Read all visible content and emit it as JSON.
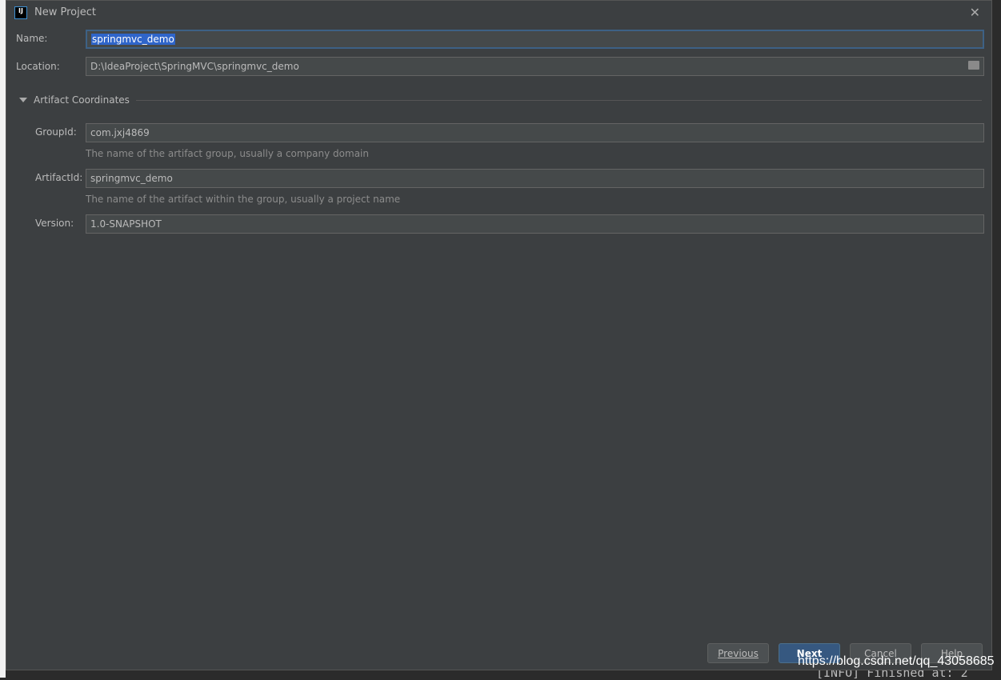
{
  "window": {
    "title": "New Project",
    "logo_text": "IJ"
  },
  "form": {
    "name": {
      "label": "Name:",
      "value": "springmvc_demo"
    },
    "location": {
      "label": "Location:",
      "value": "D:\\IdeaProject\\SpringMVC\\springmvc_demo"
    },
    "section": "Artifact Coordinates",
    "group_id": {
      "label": "GroupId:",
      "value": "com.jxj4869",
      "hint": "The name of the artifact group, usually a company domain"
    },
    "artifact_id": {
      "label": "ArtifactId:",
      "value": "springmvc_demo",
      "hint": "The name of the artifact within the group, usually a project name"
    },
    "version": {
      "label": "Version:",
      "value": "1.0-SNAPSHOT"
    }
  },
  "buttons": {
    "previous": "Previous",
    "next": "Next",
    "cancel": "Cancel",
    "help": "Help"
  },
  "background": {
    "console_line": "[INFO] Finished at: 2"
  },
  "watermark": "https://blog.csdn.net/qq_43058685"
}
